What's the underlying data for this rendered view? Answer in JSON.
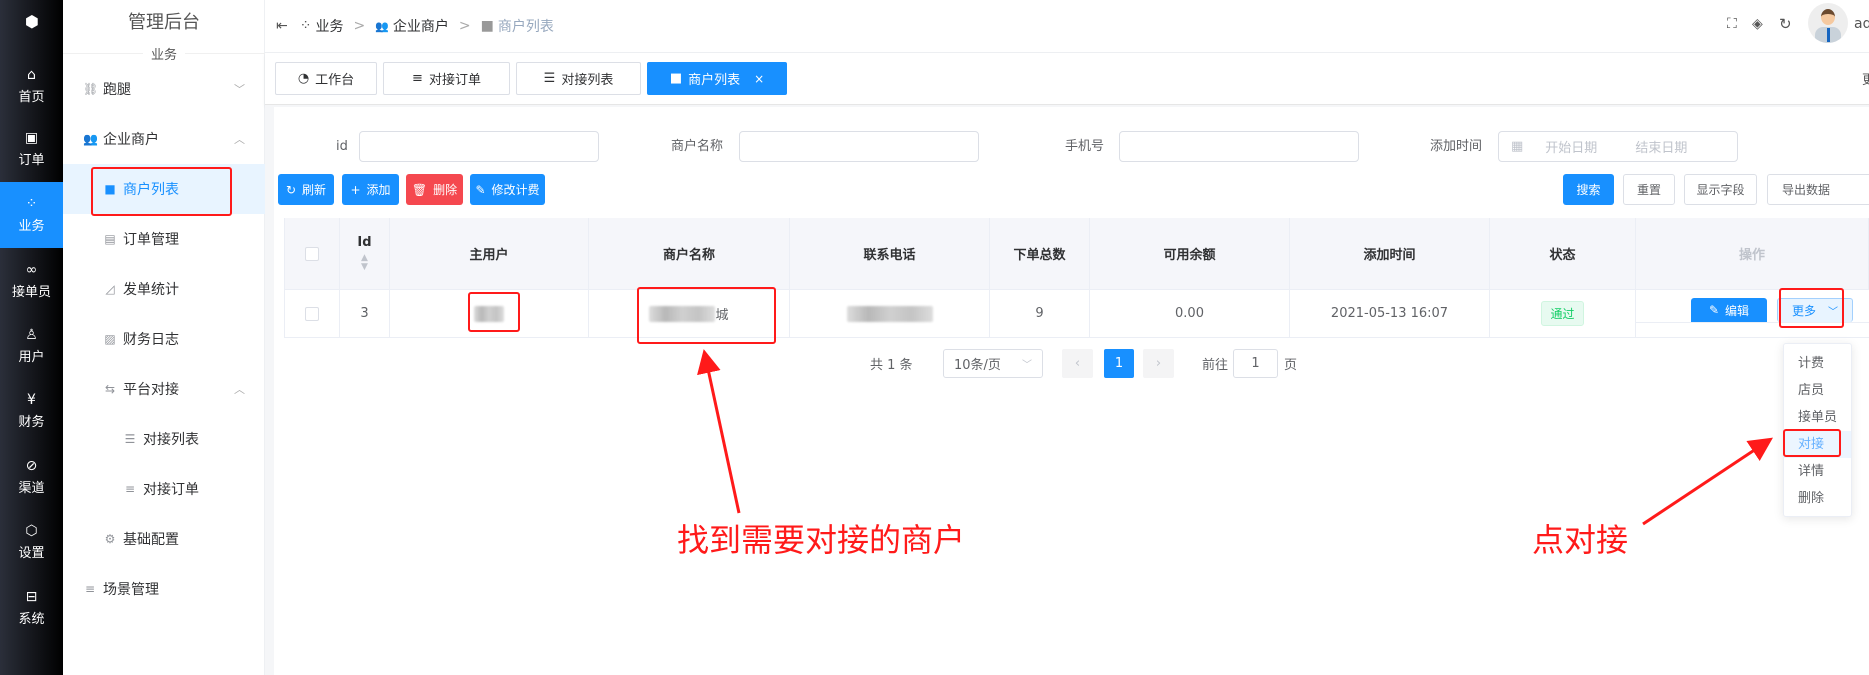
{
  "rail": {
    "items": [
      {
        "label": "首页",
        "icon": "home-icon"
      },
      {
        "label": "订单",
        "icon": "order-icon"
      },
      {
        "label": "业务",
        "icon": "grid-icon",
        "active": true
      },
      {
        "label": "接单员",
        "icon": "bike-icon"
      },
      {
        "label": "用户",
        "icon": "user-icon"
      },
      {
        "label": "财务",
        "icon": "yen-icon"
      },
      {
        "label": "渠道",
        "icon": "compass-icon"
      },
      {
        "label": "设置",
        "icon": "settings-icon"
      },
      {
        "label": "系统",
        "icon": "system-icon"
      }
    ]
  },
  "sidebar": {
    "title": "管理后台",
    "section": "业务",
    "items": [
      {
        "label": "跑腿",
        "icon": "errand-icon"
      },
      {
        "label": "企业商户",
        "icon": "users-icon"
      },
      {
        "label": "商户列表",
        "icon": "id-card-icon",
        "active": true
      },
      {
        "label": "订单管理",
        "icon": "doc-icon"
      },
      {
        "label": "发单统计",
        "icon": "chart-icon"
      },
      {
        "label": "财务日志",
        "icon": "edit-doc-icon"
      },
      {
        "label": "平台对接",
        "icon": "swap-icon"
      },
      {
        "label": "对接列表",
        "icon": "list-icon"
      },
      {
        "label": "对接订单",
        "icon": "lines-icon"
      },
      {
        "label": "基础配置",
        "icon": "gear-icon"
      },
      {
        "label": "场景管理",
        "icon": "lines-icon"
      }
    ]
  },
  "breadcrumb": [
    "业务",
    "企业商户",
    "商户列表"
  ],
  "header": {
    "user": "ad"
  },
  "tabs": [
    {
      "label": "工作台"
    },
    {
      "label": "对接订单"
    },
    {
      "label": "对接列表"
    },
    {
      "label": "商户列表",
      "active": true,
      "close": "×"
    }
  ],
  "tabs_more": "更",
  "filters": {
    "id_label": "id",
    "id_value": "",
    "name_label": "商户名称",
    "name_value": "",
    "phone_label": "手机号",
    "phone_value": "",
    "time_label": "添加时间",
    "start_placeholder": "开始日期",
    "end_placeholder": "结束日期"
  },
  "toolbar": {
    "refresh": "刷新",
    "add": "添加",
    "delete": "删除",
    "edit_fee": "修改计费",
    "search": "搜索",
    "reset": "重置",
    "columns": "显示字段",
    "export": "导出数据"
  },
  "table": {
    "headers": [
      "Id",
      "主用户",
      "商户名称",
      "联系电话",
      "下单总数",
      "可用余额",
      "添加时间",
      "状态",
      "操作"
    ],
    "rows": [
      {
        "id": "3",
        "main_user": "",
        "name_suffix": "城",
        "phone": "",
        "orders": "9",
        "balance": "0.00",
        "time": "2021-05-13 16:07",
        "status": "通过",
        "edit": "编辑",
        "more": "更多"
      }
    ]
  },
  "pagination": {
    "total": "共 1 条",
    "page_size": "10条/页",
    "current": "1",
    "goto": "前往",
    "goto_value": "1",
    "page_unit": "页"
  },
  "more_menu": [
    "计费",
    "店员",
    "接单员",
    "对接",
    "详情",
    "删除"
  ],
  "annotations": {
    "left": "找到需要对接的商户",
    "right": "点对接"
  },
  "colors": {
    "primary": "#1890ff",
    "danger": "#f5484f",
    "annotation": "#ff1a1a",
    "success": "#13ce66"
  }
}
